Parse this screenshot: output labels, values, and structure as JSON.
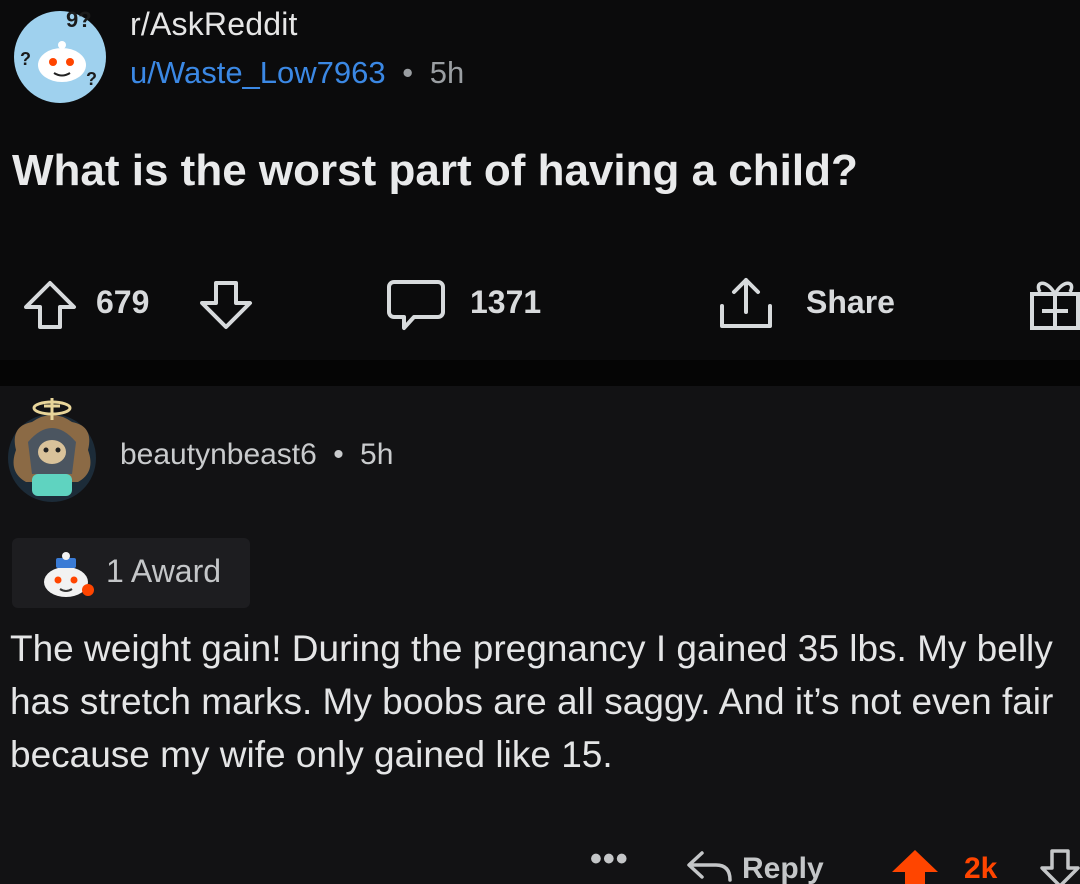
{
  "post": {
    "subreddit": "r/AskReddit",
    "author": "u/Waste_Low7963",
    "separator_dot": "•",
    "age": "5h",
    "title": "What is the worst part of having a child?",
    "upvotes": "679",
    "comments": "1371",
    "share_label": "Share",
    "icons": [
      "subreddit-avatar-icon",
      "upvote-arrow-icon",
      "downvote-arrow-icon",
      "comment-bubble-icon",
      "share-icon",
      "award-gift-icon"
    ]
  },
  "comment": {
    "username": "beautynbeast6",
    "separator_dot": "•",
    "age": "5h",
    "award_label": "1 Award",
    "body": "The weight gain! During the pregnancy I gained 35 lbs. My belly has stretch marks. My boobs are all saggy. And it’s not even fair because my wife only gained like 15.",
    "more_label": "•••",
    "reply_label": "Reply",
    "score": "2k",
    "icons": [
      "user-avatar-icon",
      "award-icon",
      "more-options-icon",
      "reply-icon",
      "upvote-arrow-icon",
      "downvote-arrow-icon"
    ]
  },
  "colors": {
    "background": "#0b0b0c",
    "comment_background": "#121214",
    "author_link": "#3b88e4",
    "upvote_active": "#ff4500",
    "text_primary": "#e9eaeb",
    "text_secondary": "#9a9ea2"
  }
}
